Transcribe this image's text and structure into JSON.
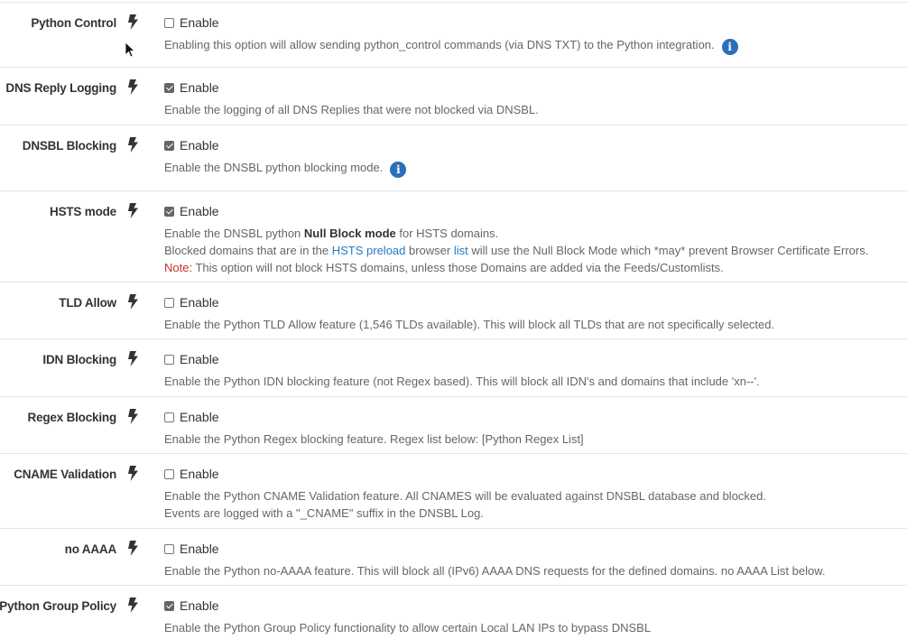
{
  "checkbox_label": "Enable",
  "rows": [
    {
      "label": "Python Control",
      "checked": false,
      "help": "Enabling this option will allow sending python_control commands (via DNS TXT) to the Python integration.",
      "has_info": true
    },
    {
      "label": "DNS Reply Logging",
      "checked": true,
      "help": "Enable the logging of all DNS Replies that were not blocked via DNSBL."
    },
    {
      "label": "DNSBL Blocking",
      "checked": true,
      "help": "Enable the DNSBL python blocking mode.",
      "has_info": true
    },
    {
      "label": "HSTS mode",
      "checked": true,
      "help_line1_pre": "Enable the DNSBL python ",
      "help_line1_bold": "Null Block mode",
      "help_line1_post": " for HSTS domains.",
      "help_line2_pre": "Blocked domains that are in the ",
      "help_line2_link1": "HSTS preload",
      "help_line2_mid": " browser ",
      "help_line2_link2": "list",
      "help_line2_post": " will use the Null Block Mode which *may* prevent Browser Certificate Errors.",
      "help_line3_note": "Note:",
      "help_line3_post": " This option will not block HSTS domains, unless those Domains are added via the Feeds/Customlists."
    },
    {
      "label": "TLD Allow",
      "checked": false,
      "help": "Enable the Python TLD Allow feature (1,546 TLDs available). This will block all TLDs that are not specifically selected."
    },
    {
      "label": "IDN Blocking",
      "checked": false,
      "help": "Enable the Python IDN blocking feature (not Regex based). This will block all IDN's and domains that include 'xn--'."
    },
    {
      "label": "Regex Blocking",
      "checked": false,
      "help": "Enable the Python Regex blocking feature. Regex list below: [Python Regex List]"
    },
    {
      "label": "CNAME Validation",
      "checked": false,
      "help": "Enable the Python CNAME Validation feature. All CNAMES will be evaluated against DNSBL database and blocked.",
      "help2": "Events are logged with a \"_CNAME\" suffix in the DNSBL Log."
    },
    {
      "label": "no AAAA",
      "checked": false,
      "help": "Enable the Python no-AAAA feature. This will block all (IPv6) AAAA DNS requests for the defined domains. no AAAA List below."
    },
    {
      "label": "Python Group Policy",
      "checked": true,
      "help": "Enable the Python Group Policy functionality to allow certain Local LAN IPs to bypass DNSBL"
    }
  ],
  "icons": {
    "bolt": "bolt-icon",
    "info": "info-icon",
    "info_glyph": "i"
  }
}
